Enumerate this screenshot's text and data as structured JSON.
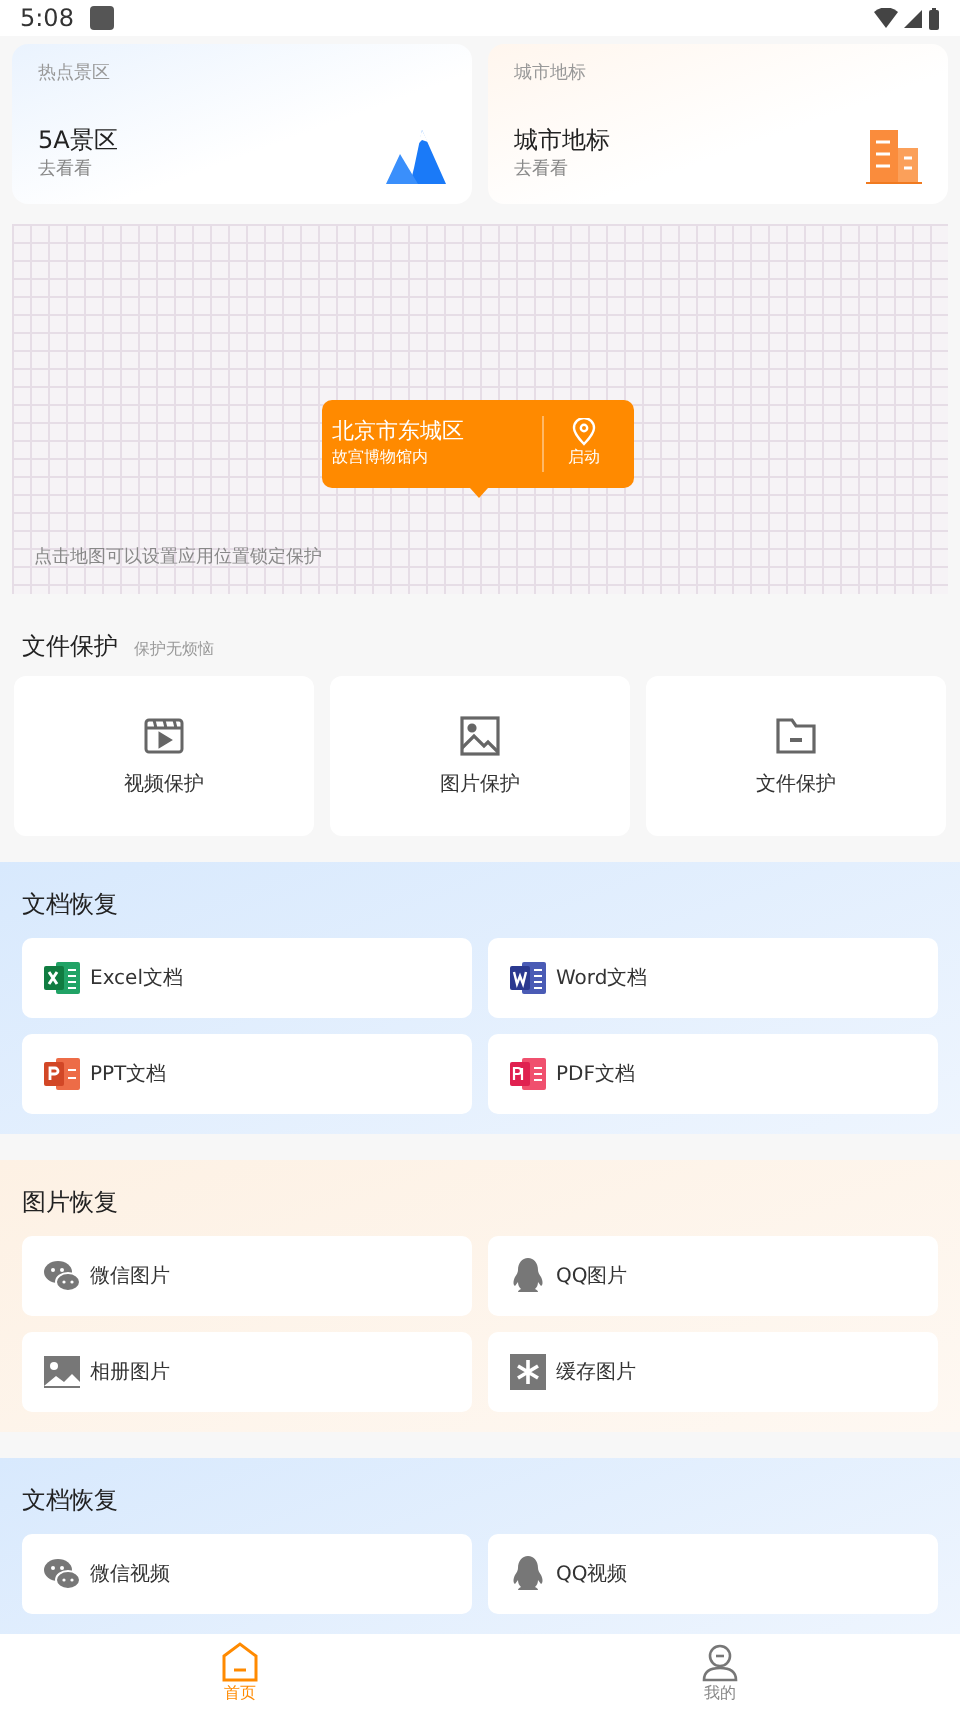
{
  "status_bar": {
    "time": "5:08"
  },
  "top_cards": [
    {
      "kind": "scenic",
      "caption": "热点景区",
      "title": "5A景区",
      "subtitle": "去看看"
    },
    {
      "kind": "landmark",
      "caption": "城市地标",
      "title": "城市地标",
      "subtitle": "去看看"
    }
  ],
  "map": {
    "location": "北京市东城区",
    "detail": "故宫博物馆内",
    "action": "启动",
    "hint": "点击地图可以设置应用位置锁定保护"
  },
  "file_protection": {
    "title": "文件保护",
    "subtitle": "保护无烦恼",
    "items": [
      {
        "kind": "video",
        "label": "视频保护"
      },
      {
        "kind": "image",
        "label": "图片保护"
      },
      {
        "kind": "folder",
        "label": "文件保护"
      }
    ]
  },
  "sections": [
    {
      "kind": "blue",
      "title": "文档恢复",
      "items": [
        {
          "kind": "excel",
          "label": "Excel文档"
        },
        {
          "kind": "word",
          "label": "Word文档"
        },
        {
          "kind": "ppt",
          "label": "PPT文档"
        },
        {
          "kind": "pdf",
          "label": "PDF文档"
        }
      ]
    },
    {
      "kind": "orange",
      "title": "图片恢复",
      "items": [
        {
          "kind": "wechat",
          "label": "微信图片"
        },
        {
          "kind": "qq",
          "label": "QQ图片"
        },
        {
          "kind": "album",
          "label": "相册图片"
        },
        {
          "kind": "cache",
          "label": "缓存图片"
        }
      ]
    },
    {
      "kind": "blue",
      "title": "文档恢复",
      "items": [
        {
          "kind": "wechat",
          "label": "微信视频"
        },
        {
          "kind": "qq",
          "label": "QQ视频"
        }
      ]
    }
  ],
  "bottom_nav": [
    {
      "kind": "home",
      "label": "首页",
      "selected": true
    },
    {
      "kind": "profile",
      "label": "我的",
      "selected": false
    }
  ]
}
